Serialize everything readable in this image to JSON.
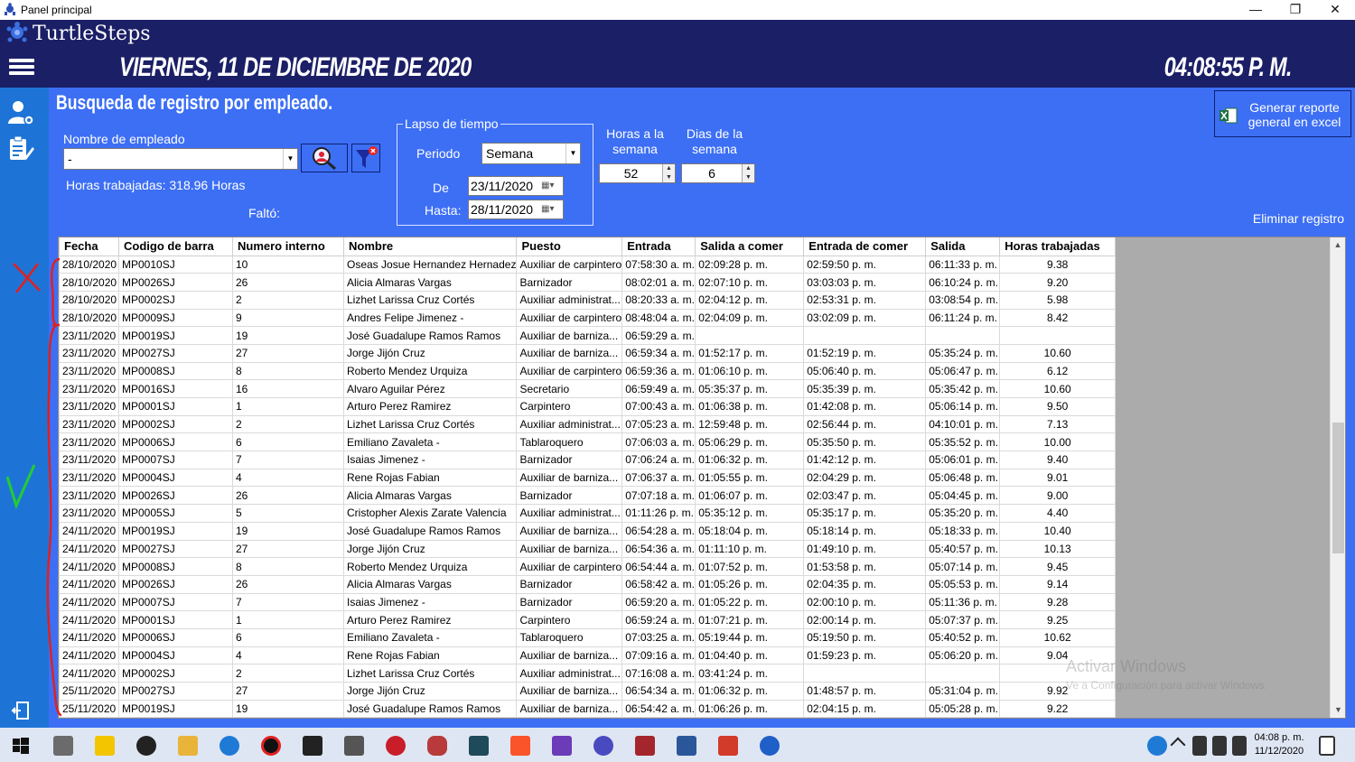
{
  "window": {
    "title": "Panel principal",
    "controls": [
      "—",
      "❐",
      "✕"
    ]
  },
  "header": {
    "brand": "TurtleSteps",
    "date": "VIERNES, 11 DE DICIEMBRE DE 2020",
    "time": "04:08:55 P. M."
  },
  "sidebar": {
    "icons": [
      "user-settings-icon",
      "report-edit-icon",
      "logout-icon"
    ]
  },
  "search": {
    "heading": "Busqueda de registro por empleado.",
    "employee_label": "Nombre de empleado",
    "employee_value": "-",
    "hours_worked": "Horas trabajadas: 318.96 Horas",
    "missed_label": "Faltó:",
    "timespan": {
      "legend": "Lapso de tiempo",
      "period_label": "Periodo",
      "period_value": "Semana",
      "from_label": "De",
      "from_value": "23/11/2020",
      "to_label": "Hasta:",
      "to_value": "28/11/2020"
    },
    "hours_week_label": "Horas a la semana",
    "hours_week_value": "52",
    "days_week_label": "Dias de la semana",
    "days_week_value": "6",
    "export_label": "Generar reporte general en excel",
    "delete_label": "Eliminar registro"
  },
  "table": {
    "columns": [
      "Fecha",
      "Codigo de barra",
      "Numero interno",
      "Nombre",
      "Puesto",
      "Entrada",
      "Salida a comer",
      "Entrada de comer",
      "Salida",
      "Horas trabajadas"
    ],
    "rows": [
      [
        "28/10/2020",
        "MP0010SJ",
        "10",
        "Oseas Josue Hernandez Hernadez",
        "Auxiliar de carpintero",
        "07:58:30 a. m.",
        "02:09:28 p. m.",
        "02:59:50 p. m.",
        "06:11:33 p. m.",
        "9.38"
      ],
      [
        "28/10/2020",
        "MP0026SJ",
        "26",
        "Alicia Almaras Vargas",
        "Barnizador",
        "08:02:01 a. m.",
        "02:07:10 p. m.",
        "03:03:03 p. m.",
        "06:10:24 p. m.",
        "9.20"
      ],
      [
        "28/10/2020",
        "MP0002SJ",
        "2",
        "Lizhet Larissa Cruz Cortés",
        "Auxiliar administrat...",
        "08:20:33 a. m.",
        "02:04:12 p. m.",
        "02:53:31 p. m.",
        "03:08:54 p. m.",
        "5.98"
      ],
      [
        "28/10/2020",
        "MP0009SJ",
        "9",
        "Andres Felipe Jimenez -",
        "Auxiliar de carpintero",
        "08:48:04 a. m.",
        "02:04:09 p. m.",
        "03:02:09 p. m.",
        "06:11:24 p. m.",
        "8.42"
      ],
      [
        "23/11/2020",
        "MP0019SJ",
        "19",
        "José Guadalupe Ramos Ramos",
        "Auxiliar de barniza...",
        "06:59:29 a. m.",
        "",
        "",
        "",
        ""
      ],
      [
        "23/11/2020",
        "MP0027SJ",
        "27",
        "Jorge Jijón Cruz",
        "Auxiliar de barniza...",
        "06:59:34 a. m.",
        "01:52:17 p. m.",
        "01:52:19 p. m.",
        "05:35:24 p. m.",
        "10.60"
      ],
      [
        "23/11/2020",
        "MP0008SJ",
        "8",
        "Roberto Mendez Urquiza",
        "Auxiliar de carpintero",
        "06:59:36 a. m.",
        "01:06:10 p. m.",
        "05:06:40 p. m.",
        "05:06:47 p. m.",
        "6.12"
      ],
      [
        "23/11/2020",
        "MP0016SJ",
        "16",
        "Alvaro Aguilar Pérez",
        "Secretario",
        "06:59:49 a. m.",
        "05:35:37 p. m.",
        "05:35:39 p. m.",
        "05:35:42 p. m.",
        "10.60"
      ],
      [
        "23/11/2020",
        "MP0001SJ",
        "1",
        "Arturo Perez Ramirez",
        "Carpintero",
        "07:00:43 a. m.",
        "01:06:38 p. m.",
        "01:42:08 p. m.",
        "05:06:14 p. m.",
        "9.50"
      ],
      [
        "23/11/2020",
        "MP0002SJ",
        "2",
        "Lizhet Larissa Cruz Cortés",
        "Auxiliar administrat...",
        "07:05:23 a. m.",
        "12:59:48 p. m.",
        "02:56:44 p. m.",
        "04:10:01 p. m.",
        "7.13"
      ],
      [
        "23/11/2020",
        "MP0006SJ",
        "6",
        "Emiliano Zavaleta -",
        "Tablaroquero",
        "07:06:03 a. m.",
        "05:06:29 p. m.",
        "05:35:50 p. m.",
        "05:35:52 p. m.",
        "10.00"
      ],
      [
        "23/11/2020",
        "MP0007SJ",
        "7",
        "Isaias Jimenez -",
        "Barnizador",
        "07:06:24 a. m.",
        "01:06:32 p. m.",
        "01:42:12 p. m.",
        "05:06:01 p. m.",
        "9.40"
      ],
      [
        "23/11/2020",
        "MP0004SJ",
        "4",
        "Rene Rojas Fabian",
        "Auxiliar de barniza...",
        "07:06:37 a. m.",
        "01:05:55 p. m.",
        "02:04:29 p. m.",
        "05:06:48 p. m.",
        "9.01"
      ],
      [
        "23/11/2020",
        "MP0026SJ",
        "26",
        "Alicia Almaras Vargas",
        "Barnizador",
        "07:07:18 a. m.",
        "01:06:07 p. m.",
        "02:03:47 p. m.",
        "05:04:45 p. m.",
        "9.00"
      ],
      [
        "23/11/2020",
        "MP0005SJ",
        "5",
        "Cristopher Alexis Zarate Valencia",
        "Auxiliar administrat...",
        "01:11:26 p. m.",
        "05:35:12 p. m.",
        "05:35:17 p. m.",
        "05:35:20 p. m.",
        "4.40"
      ],
      [
        "24/11/2020",
        "MP0019SJ",
        "19",
        "José Guadalupe Ramos Ramos",
        "Auxiliar de barniza...",
        "06:54:28 a. m.",
        "05:18:04 p. m.",
        "05:18:14 p. m.",
        "05:18:33 p. m.",
        "10.40"
      ],
      [
        "24/11/2020",
        "MP0027SJ",
        "27",
        "Jorge Jijón Cruz",
        "Auxiliar de barniza...",
        "06:54:36 a. m.",
        "01:11:10 p. m.",
        "01:49:10 p. m.",
        "05:40:57 p. m.",
        "10.13"
      ],
      [
        "24/11/2020",
        "MP0008SJ",
        "8",
        "Roberto Mendez Urquiza",
        "Auxiliar de carpintero",
        "06:54:44 a. m.",
        "01:07:52 p. m.",
        "01:53:58 p. m.",
        "05:07:14 p. m.",
        "9.45"
      ],
      [
        "24/11/2020",
        "MP0026SJ",
        "26",
        "Alicia Almaras Vargas",
        "Barnizador",
        "06:58:42 a. m.",
        "01:05:26 p. m.",
        "02:04:35 p. m.",
        "05:05:53 p. m.",
        "9.14"
      ],
      [
        "24/11/2020",
        "MP0007SJ",
        "7",
        "Isaias Jimenez -",
        "Barnizador",
        "06:59:20 a. m.",
        "01:05:22 p. m.",
        "02:00:10 p. m.",
        "05:11:36 p. m.",
        "9.28"
      ],
      [
        "24/11/2020",
        "MP0001SJ",
        "1",
        "Arturo Perez Ramirez",
        "Carpintero",
        "06:59:24 a. m.",
        "01:07:21 p. m.",
        "02:00:14 p. m.",
        "05:07:37 p. m.",
        "9.25"
      ],
      [
        "24/11/2020",
        "MP0006SJ",
        "6",
        "Emiliano Zavaleta -",
        "Tablaroquero",
        "07:03:25 a. m.",
        "05:19:44 p. m.",
        "05:19:50 p. m.",
        "05:40:52 p. m.",
        "10.62"
      ],
      [
        "24/11/2020",
        "MP0004SJ",
        "4",
        "Rene Rojas Fabian",
        "Auxiliar de barniza...",
        "07:09:16 a. m.",
        "01:04:40 p. m.",
        "01:59:23 p. m.",
        "05:06:20 p. m.",
        "9.04"
      ],
      [
        "24/11/2020",
        "MP0002SJ",
        "2",
        "Lizhet Larissa Cruz Cortés",
        "Auxiliar administrat...",
        "07:16:08 a. m.",
        "03:41:24 p. m.",
        "",
        "",
        ""
      ],
      [
        "25/11/2020",
        "MP0027SJ",
        "27",
        "Jorge Jijón Cruz",
        "Auxiliar de barniza...",
        "06:54:34 a. m.",
        "01:06:32 p. m.",
        "01:48:57 p. m.",
        "05:31:04 p. m.",
        "9.92"
      ],
      [
        "25/11/2020",
        "MP0019SJ",
        "19",
        "José Guadalupe Ramos Ramos",
        "Auxiliar de barniza...",
        "06:54:42 a. m.",
        "01:06:26 p. m.",
        "02:04:15 p. m.",
        "05:05:28 p. m.",
        "9.22"
      ]
    ]
  },
  "watermark": {
    "line1": "Activar Windows",
    "line2": "Ve a Configuración para activar Windows."
  },
  "taskbar": {
    "clock_time": "04:08 p. m.",
    "clock_date": "11/12/2020"
  },
  "colors": {
    "header": "#1b1f66",
    "panel": "#3d6ff5",
    "sidebar": "#1e74d6",
    "annotation_red": "#e02020",
    "annotation_green": "#22cc33"
  }
}
